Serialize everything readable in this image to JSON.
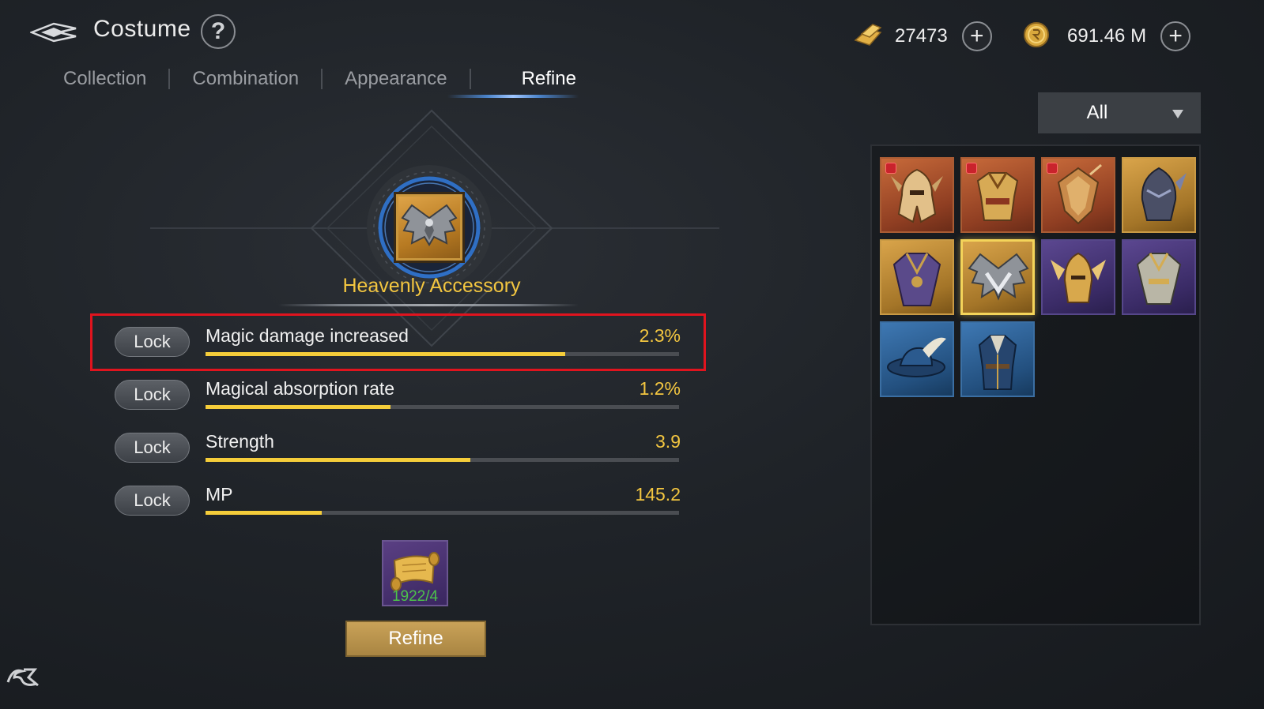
{
  "header": {
    "title": "Costume",
    "help_label": "?",
    "currencies": [
      {
        "icon": "gold-bar-icon",
        "value": "27473",
        "add_label": "+"
      },
      {
        "icon": "gold-coin-icon",
        "value": "691.46 M",
        "add_label": "+"
      }
    ]
  },
  "tabs": [
    {
      "label": "Collection",
      "active": false
    },
    {
      "label": "Combination",
      "active": false
    },
    {
      "label": "Appearance",
      "active": false
    },
    {
      "label": "Refine",
      "active": true
    }
  ],
  "item": {
    "name": "Heavenly Accessory",
    "icon": "winged-accessory-icon"
  },
  "stats": [
    {
      "lock_label": "Lock",
      "label": "Magic damage increased",
      "value": "2.3%",
      "fill": 0.76,
      "highlighted": true
    },
    {
      "lock_label": "Lock",
      "label": "Magical absorption rate",
      "value": "1.2%",
      "fill": 0.39,
      "highlighted": false
    },
    {
      "lock_label": "Lock",
      "label": "Strength",
      "value": "3.9",
      "fill": 0.56,
      "highlighted": false
    },
    {
      "lock_label": "Lock",
      "label": "MP",
      "value": "145.2",
      "fill": 0.245,
      "highlighted": false
    }
  ],
  "material": {
    "icon": "scroll-icon",
    "count": "1922/4"
  },
  "refine_label": "Refine",
  "filter": {
    "selected": "All"
  },
  "colors": {
    "accent": "#f3c640",
    "highlight_border": "#e0141e",
    "bar_fill": "#f5cd3a",
    "count_green": "#4cc24a"
  },
  "costumes": [
    {
      "rarity": "orange",
      "icon": "horned-helmet-icon",
      "tagged": true,
      "selected": false
    },
    {
      "rarity": "orange",
      "icon": "gold-armor-icon",
      "tagged": true,
      "selected": false
    },
    {
      "rarity": "orange",
      "icon": "ornate-shield-icon",
      "tagged": true,
      "selected": false
    },
    {
      "rarity": "gold",
      "icon": "dark-helmet-icon",
      "tagged": false,
      "selected": false
    },
    {
      "rarity": "gold",
      "icon": "purple-armor-icon",
      "tagged": false,
      "selected": false
    },
    {
      "rarity": "gold",
      "icon": "winged-accessory-icon",
      "tagged": false,
      "selected": true
    },
    {
      "rarity": "purple",
      "icon": "winged-helmet-icon",
      "tagged": false,
      "selected": false
    },
    {
      "rarity": "purple",
      "icon": "silver-armor-icon",
      "tagged": false,
      "selected": false
    },
    {
      "rarity": "blue",
      "icon": "feathered-hat-icon",
      "tagged": false,
      "selected": false
    },
    {
      "rarity": "blue",
      "icon": "blue-coat-icon",
      "tagged": false,
      "selected": false
    }
  ]
}
